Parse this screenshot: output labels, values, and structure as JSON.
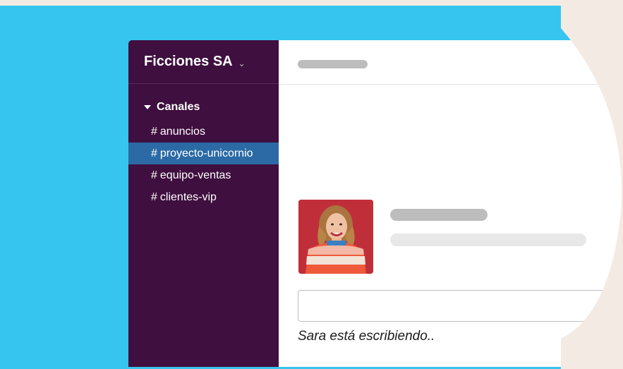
{
  "workspace": {
    "name": "Ficciones SA"
  },
  "sidebar": {
    "section_label": "Canales",
    "channels": [
      {
        "prefix": "#",
        "label": "anuncios",
        "active": false
      },
      {
        "prefix": "#",
        "label": "proyecto-unicornio",
        "active": true
      },
      {
        "prefix": "#",
        "label": "equipo-ventas",
        "active": false
      },
      {
        "prefix": "#",
        "label": "clientes-vip",
        "active": false
      }
    ]
  },
  "composer": {
    "typing_indicator": "Sara está escribiendo.."
  },
  "colors": {
    "background_blue": "#36c5ee",
    "sidebar_purple": "#3f0f3f",
    "active_channel": "#2b6aa5",
    "page_background": "#f3ebe3"
  }
}
